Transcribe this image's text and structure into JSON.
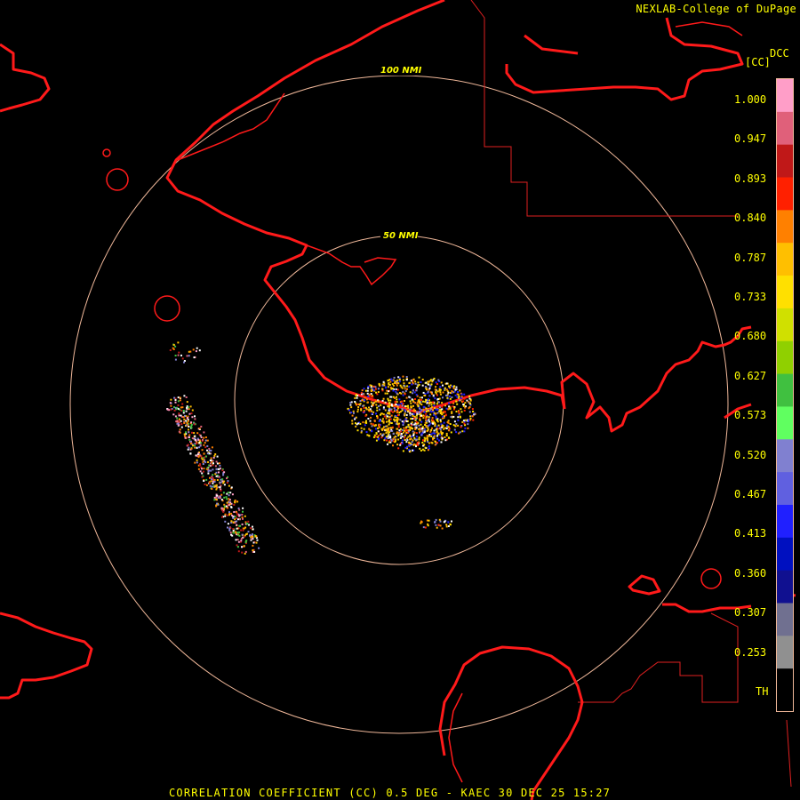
{
  "credit": "NEXLAB-College of DuPage",
  "product_code": "DCC",
  "unit": "[CC]",
  "footer_title": "CORRELATION COEFFICIENT (CC) 0.5 DEG - KAEC 30 DEC 25 15:27",
  "range_rings": [
    "50 NMI",
    "100 NMI"
  ],
  "legend": {
    "ticks": [
      "1.000",
      "0.947",
      "0.893",
      "0.840",
      "0.787",
      "0.733",
      "0.680",
      "0.627",
      "0.573",
      "0.520",
      "0.467",
      "0.413",
      "0.360",
      "0.307",
      "0.253",
      "TH"
    ],
    "colors_top_to_bottom": [
      "#ff9ec8",
      "#e0607a",
      "#c01818",
      "#ff2000",
      "#ff8000",
      "#ffbf00",
      "#ffe000",
      "#d0e000",
      "#90d000",
      "#40c040",
      "#60ff60",
      "#8080d0",
      "#6060e0",
      "#2020ff",
      "#0010c0",
      "#101090",
      "#707090",
      "#909090",
      "#000000"
    ]
  },
  "colors": {
    "coast": "#ff1a1a",
    "ring": "#f0b89a",
    "label": "#ffff00"
  }
}
